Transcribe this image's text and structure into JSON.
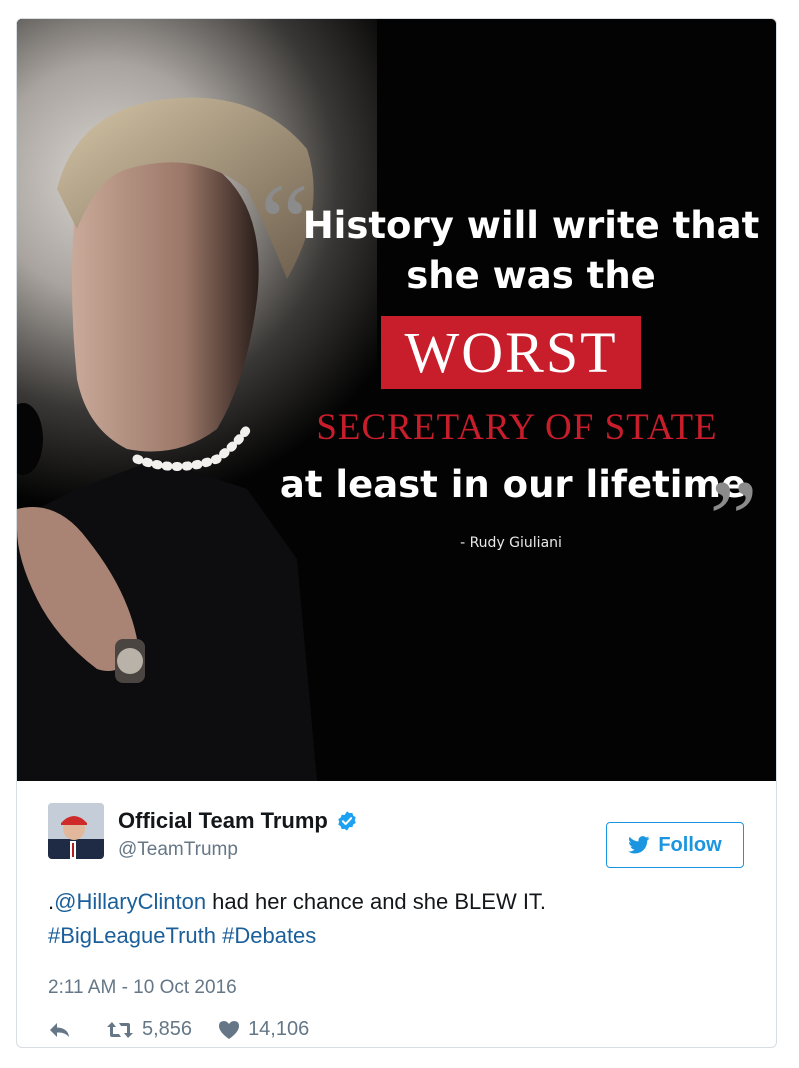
{
  "image": {
    "quote_line_1": "History will write that",
    "quote_line_2": "she was the",
    "quote_highlight": "WORST",
    "quote_line_4": "SECRETARY OF STATE",
    "quote_line_5": "at least in our lifetime",
    "attribution": "- Rudy Giuliani",
    "open_quote": "“",
    "close_quote": "”"
  },
  "tweet": {
    "display_name": "Official Team Trump",
    "handle": "@TeamTrump",
    "verified": true,
    "follow_label": "Follow",
    "text_prefix": ".",
    "mention": "@HillaryClinton",
    "text_rest": " had her chance and she BLEW IT.",
    "hashtag_1": "#BigLeagueTruth",
    "hashtag_2": "#Debates",
    "timestamp": "2:11 AM - 10 Oct 2016",
    "retweet_count": "5,856",
    "like_count": "14,106"
  },
  "icons": {
    "verified": "verified-badge-icon",
    "follow": "twitter-bird-icon",
    "reply": "reply-icon",
    "retweet": "retweet-icon",
    "like": "heart-icon"
  },
  "colors": {
    "accent": "#1b95e0",
    "link": "#1b5f9a",
    "highlight_red": "#c81d2b",
    "muted": "#657786"
  }
}
